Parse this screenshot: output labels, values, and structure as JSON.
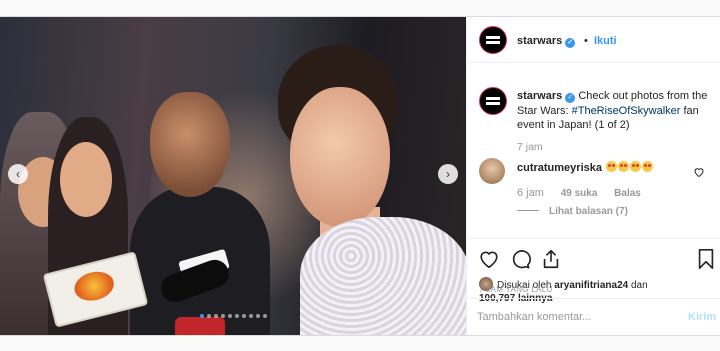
{
  "account": {
    "username": "starwars",
    "verified": true
  },
  "header": {
    "separator": "•",
    "follow_label": "Ikuti"
  },
  "caption": {
    "username": "starwars",
    "text_before": "Check out photos from the Star Wars: ",
    "hashtag": "#TheRiseOfSkywalker",
    "text_after": " fan event in Japan! (1 of 2)",
    "time": "7 jam"
  },
  "comment": {
    "username": "cutratumeyriska",
    "emoji_count": 4,
    "time": "6 jam",
    "likes": "49 suka",
    "reply_label": "Balas",
    "view_replies": "Lihat balasan (7)"
  },
  "likes": {
    "prefix": "Disukai oleh",
    "user": "aryanifitriana24",
    "conjunction": "dan",
    "count": "100,797",
    "suffix": "lainnya"
  },
  "post_time": "7 JAM YANG LALU",
  "comment_box": {
    "placeholder": "Tambahkan komentar...",
    "send_label": "Kirim"
  },
  "carousel": {
    "total": 10,
    "current": 1
  },
  "colors": {
    "accent": "#3897f0",
    "send_disabled": "#b2dffc",
    "muted": "#999999"
  },
  "icons": [
    "chevron-left-icon",
    "chevron-right-icon",
    "verified-icon",
    "heart-icon",
    "comment-icon",
    "share-icon",
    "bookmark-icon"
  ]
}
